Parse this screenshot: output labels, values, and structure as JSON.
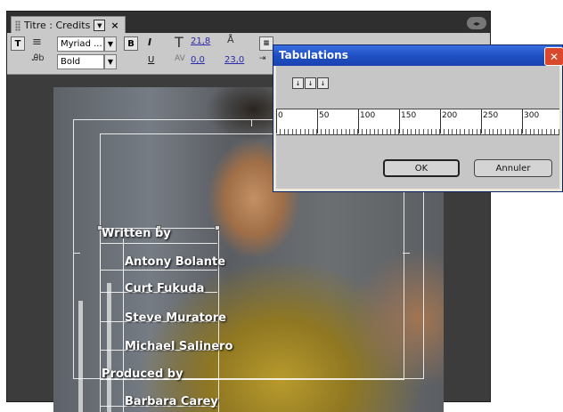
{
  "panel": {
    "tab_label": "Titre : Credits",
    "tab_menu_icon": "dropdown-arrow-icon",
    "tab_close": "×"
  },
  "toolbar": {
    "font_family": "Myriad ...",
    "font_style": "Bold",
    "bold_label": "B",
    "italic_label": "I",
    "underline_label": "U",
    "font_size": "21,8",
    "kerning": "0,0",
    "leading": "23,0"
  },
  "dialog": {
    "title": "Tabulations",
    "close_label": "✕",
    "ruler_labels": [
      "0",
      "50",
      "100",
      "150",
      "200",
      "250",
      "300"
    ],
    "ok_label": "OK",
    "cancel_label": "Annuler"
  },
  "credits": [
    "Written by",
    "Antony Bolante",
    "Curt Fukuda",
    "Steve Muratore",
    "Michael Salinero",
    "Produced by",
    "Barbara Carey"
  ]
}
